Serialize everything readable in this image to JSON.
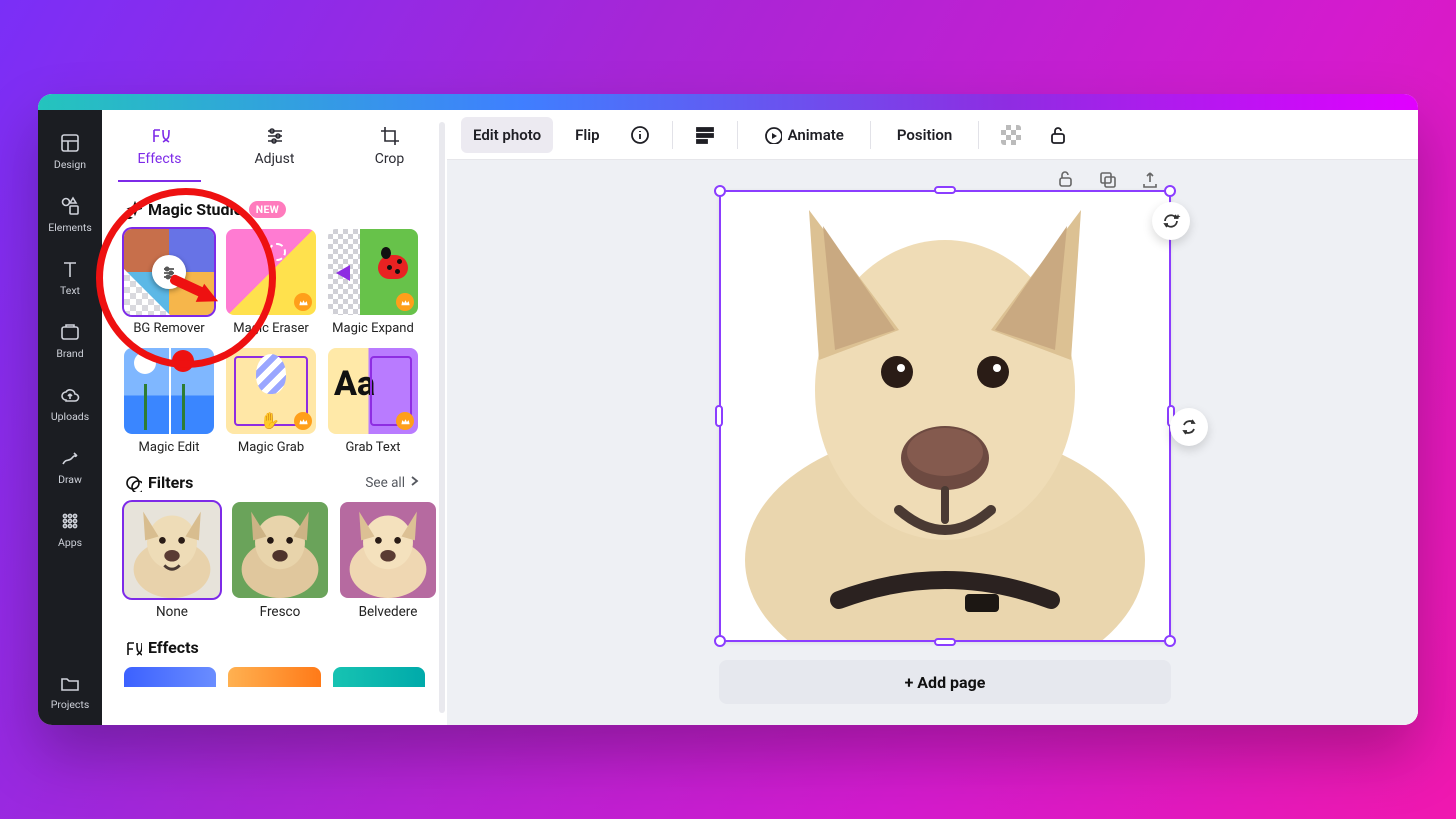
{
  "rail": {
    "items": [
      {
        "label": "Design"
      },
      {
        "label": "Elements"
      },
      {
        "label": "Text"
      },
      {
        "label": "Brand"
      },
      {
        "label": "Uploads"
      },
      {
        "label": "Draw"
      },
      {
        "label": "Apps"
      },
      {
        "label": "Projects"
      }
    ]
  },
  "panel": {
    "tabs": {
      "effects": "Effects",
      "adjust": "Adjust",
      "crop": "Crop",
      "active": "effects"
    },
    "magic": {
      "title": "Magic Studio",
      "badge": "NEW",
      "tools": [
        {
          "label": "BG Remover"
        },
        {
          "label": "Magic Eraser"
        },
        {
          "label": "Magic Expand"
        },
        {
          "label": "Magic Edit"
        },
        {
          "label": "Magic Grab"
        },
        {
          "label": "Grab Text"
        }
      ]
    },
    "filters": {
      "title": "Filters",
      "see_all": "See all",
      "items": [
        {
          "label": "None"
        },
        {
          "label": "Fresco"
        },
        {
          "label": "Belvedere"
        }
      ]
    },
    "effects": {
      "title": "Effects"
    }
  },
  "toolbar": {
    "edit_photo": "Edit photo",
    "flip": "Flip",
    "animate": "Animate",
    "position": "Position"
  },
  "stage": {
    "add_page": "+ Add page"
  },
  "annotation": {
    "target": "BG Remover",
    "shape": "red circle with arrow"
  }
}
